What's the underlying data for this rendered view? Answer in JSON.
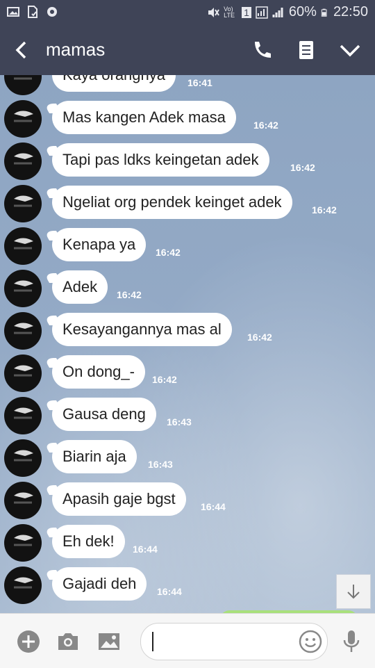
{
  "status_bar": {
    "battery_percent": "60%",
    "time": "22:50",
    "volte": "Vo) LTE",
    "sim": "1"
  },
  "header": {
    "title": "mamas"
  },
  "messages": [
    {
      "text": "Kaya orangnya",
      "time": "16:41"
    },
    {
      "text": "Mas kangen Adek masa",
      "time": "16:42"
    },
    {
      "text": "Tapi pas ldks keingetan adek",
      "time": "16:42"
    },
    {
      "text": "Ngeliat org pendek keinget adek",
      "time": "16:42"
    },
    {
      "text": "Kenapa ya",
      "time": "16:42"
    },
    {
      "text": "Adek",
      "time": "16:42"
    },
    {
      "text": "Kesayangannya mas al",
      "time": "16:42"
    },
    {
      "text": "On dong_-",
      "time": "16:42"
    },
    {
      "text": "Gausa deng",
      "time": "16:43"
    },
    {
      "text": "Biarin aja",
      "time": "16:43"
    },
    {
      "text": "Apasih gaje bgst",
      "time": "16:44"
    },
    {
      "text": "Eh dek!",
      "time": "16:44"
    },
    {
      "text": "Gajadi deh",
      "time": "16:44"
    }
  ],
  "input": {
    "value": ""
  },
  "icons": {
    "header": [
      "back-arrow-icon",
      "phone-icon",
      "notes-icon",
      "chevron-down-icon"
    ],
    "bottom": [
      "plus-icon",
      "camera-icon",
      "image-icon",
      "emoji-icon",
      "microphone-icon"
    ]
  },
  "colors": {
    "header_bg": "#3f4457",
    "bubble_bg": "#ffffff",
    "own_bubble_bg": "#a9e07c"
  }
}
